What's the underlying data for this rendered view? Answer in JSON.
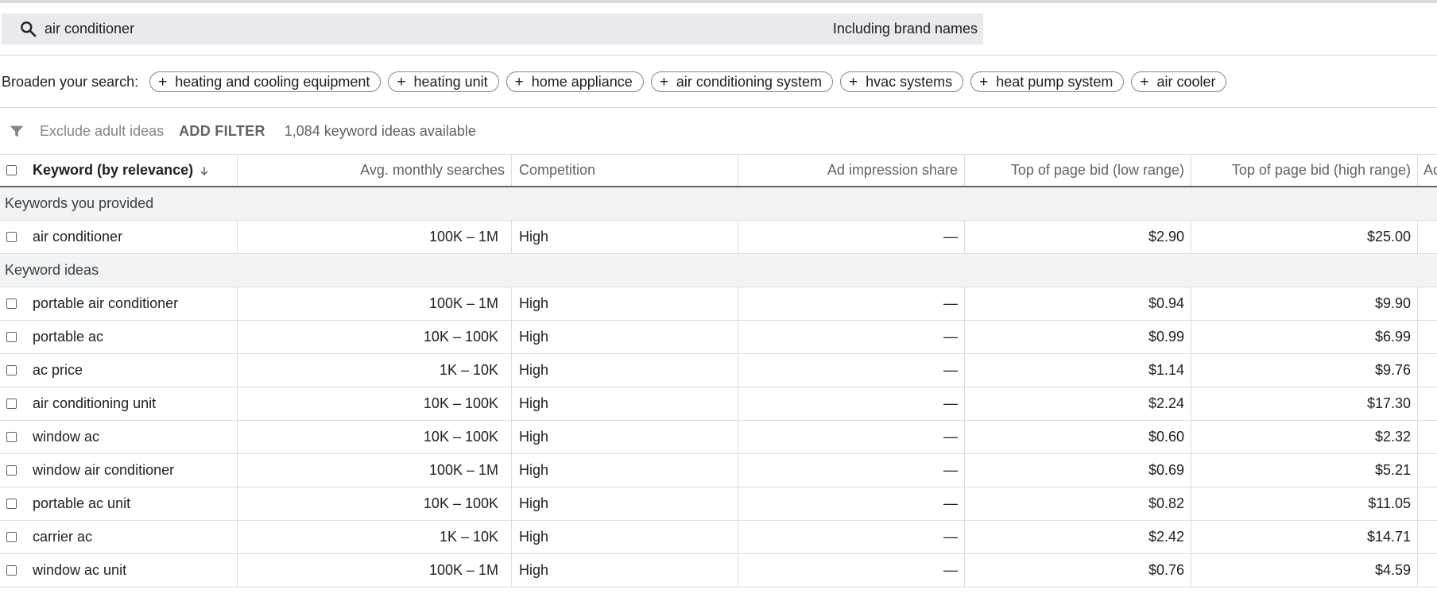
{
  "search": {
    "query": "air conditioner",
    "brand_toggle": "Including brand names"
  },
  "broaden": {
    "label": "Broaden your search:",
    "chips": [
      "heating and cooling equipment",
      "heating unit",
      "home appliance",
      "air conditioning system",
      "hvac systems",
      "heat pump system",
      "air cooler"
    ]
  },
  "filters": {
    "exclude_adult": "Exclude adult ideas",
    "add_filter": "ADD FILTER",
    "available": "1,084 keyword ideas available"
  },
  "table": {
    "headers": {
      "keyword": "Keyword (by relevance)",
      "searches": "Avg. monthly searches",
      "competition": "Competition",
      "impression": "Ad impression share",
      "bid_low": "Top of page bid (low range)",
      "bid_high": "Top of page bid (high range)",
      "overflow": "Ac"
    },
    "group_provided": "Keywords you provided",
    "provided": [
      {
        "keyword": "air conditioner",
        "searches": "100K – 1M",
        "competition": "High",
        "impression": "—",
        "bid_low": "$2.90",
        "bid_high": "$25.00"
      }
    ],
    "group_ideas": "Keyword ideas",
    "ideas": [
      {
        "keyword": "portable air conditioner",
        "searches": "100K – 1M",
        "competition": "High",
        "impression": "—",
        "bid_low": "$0.94",
        "bid_high": "$9.90"
      },
      {
        "keyword": "portable ac",
        "searches": "10K – 100K",
        "competition": "High",
        "impression": "—",
        "bid_low": "$0.99",
        "bid_high": "$6.99"
      },
      {
        "keyword": "ac price",
        "searches": "1K – 10K",
        "competition": "High",
        "impression": "—",
        "bid_low": "$1.14",
        "bid_high": "$9.76"
      },
      {
        "keyword": "air conditioning unit",
        "searches": "10K – 100K",
        "competition": "High",
        "impression": "—",
        "bid_low": "$2.24",
        "bid_high": "$17.30"
      },
      {
        "keyword": "window ac",
        "searches": "10K – 100K",
        "competition": "High",
        "impression": "—",
        "bid_low": "$0.60",
        "bid_high": "$2.32"
      },
      {
        "keyword": "window air conditioner",
        "searches": "100K – 1M",
        "competition": "High",
        "impression": "—",
        "bid_low": "$0.69",
        "bid_high": "$5.21"
      },
      {
        "keyword": "portable ac unit",
        "searches": "10K – 100K",
        "competition": "High",
        "impression": "—",
        "bid_low": "$0.82",
        "bid_high": "$11.05"
      },
      {
        "keyword": "carrier ac",
        "searches": "1K – 10K",
        "competition": "High",
        "impression": "—",
        "bid_low": "$2.42",
        "bid_high": "$14.71"
      },
      {
        "keyword": "window ac unit",
        "searches": "100K – 1M",
        "competition": "High",
        "impression": "—",
        "bid_low": "$0.76",
        "bid_high": "$4.59"
      }
    ]
  },
  "colors": {
    "search_bg": "#e8eaed",
    "group_bg": "#f1f3f4",
    "border": "#dadce0",
    "muted_text": "#5f6368"
  },
  "icons": {
    "search": "search-icon",
    "filter": "filter-icon",
    "sort": "arrow-down-icon",
    "checkbox": "checkbox-icon"
  }
}
